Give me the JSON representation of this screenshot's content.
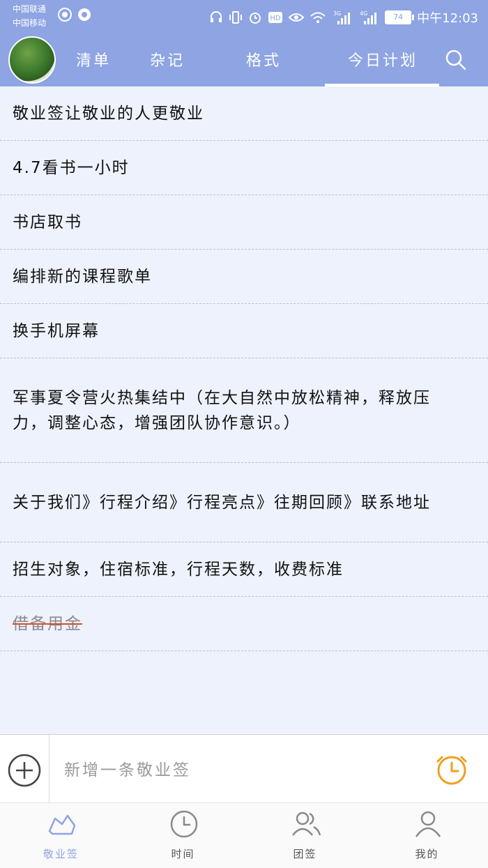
{
  "status": {
    "carrier1": "中国联通",
    "carrier2": "中国移动",
    "battery": "74",
    "time": "中午12:03",
    "network1": "3G",
    "network2": "4G"
  },
  "tabs": [
    {
      "label": "清单"
    },
    {
      "label": "杂记"
    },
    {
      "label": "格式"
    },
    {
      "label": "今日计划",
      "active": true
    }
  ],
  "items": [
    {
      "text": "敬业签让敬业的人更敬业"
    },
    {
      "text": "4.7看书一小时"
    },
    {
      "text": "书店取书"
    },
    {
      "text": "编排新的课程歌单"
    },
    {
      "text": "换手机屏幕"
    },
    {
      "text": "军事夏令营火热集结中（在大自然中放松精神，释放压力，调整心态，增强团队协作意识。）"
    },
    {
      "text": "关于我们》行程介绍》行程亮点》往期回顾》联系地址"
    },
    {
      "text": "招生对象，住宿标准，行程天数，收费标准"
    },
    {
      "text": "借备用金",
      "done": true
    }
  ],
  "input": {
    "placeholder": "新增一条敬业签"
  },
  "nav": [
    {
      "label": "敬业签",
      "icon": "note-icon",
      "active": true
    },
    {
      "label": "时间",
      "icon": "clock-icon"
    },
    {
      "label": "团签",
      "icon": "group-icon"
    },
    {
      "label": "我的",
      "icon": "user-icon"
    }
  ],
  "colors": {
    "header": "#8ea4e3",
    "list_bg": "#eef2fc",
    "accent_orange": "#f0a020",
    "strike": "#d94a32"
  }
}
